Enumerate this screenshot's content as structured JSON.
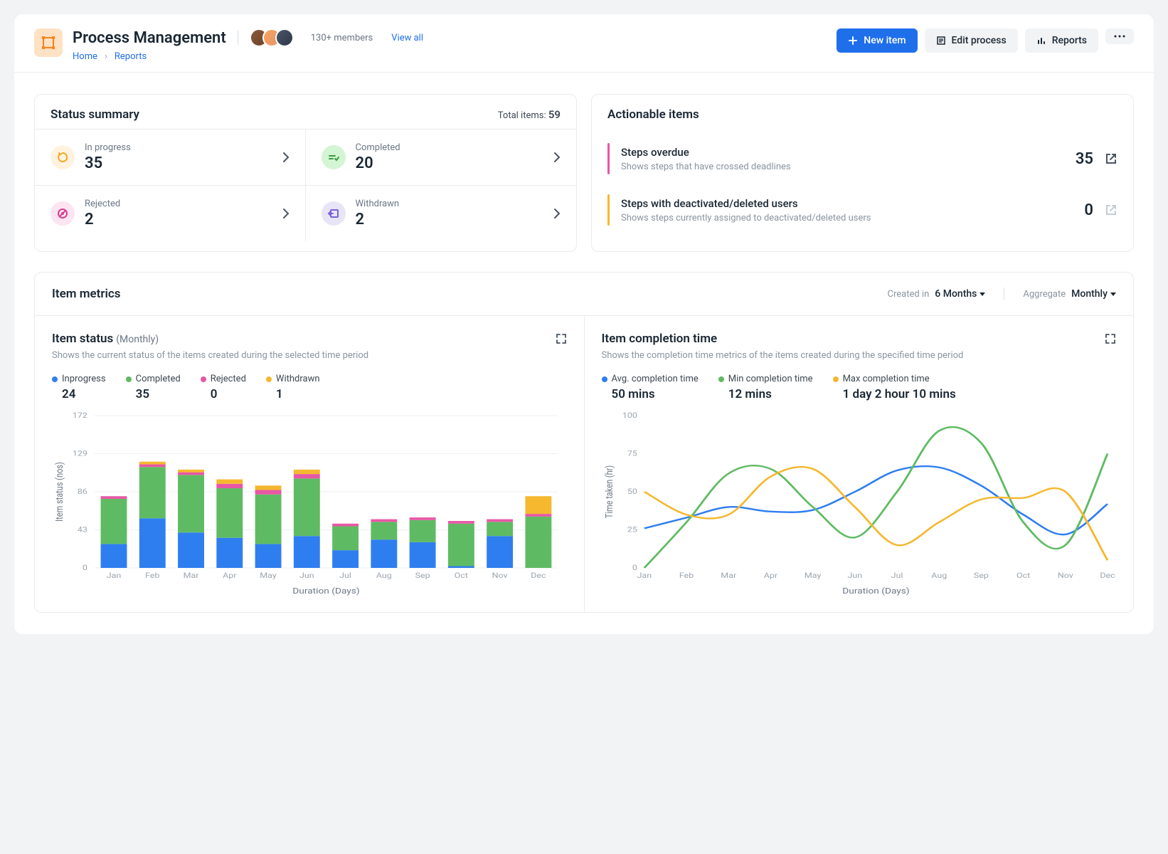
{
  "header": {
    "title": "Process Management",
    "members": "130+ members",
    "view_all": "View all",
    "breadcrumb": {
      "home": "Home",
      "current": "Reports"
    },
    "actions": {
      "new_item": "New item",
      "edit_process": "Edit process",
      "reports": "Reports"
    }
  },
  "status_summary": {
    "title": "Status summary",
    "total_label": "Total items:",
    "total_value": "59",
    "items": [
      {
        "label": "In progress",
        "value": "35"
      },
      {
        "label": "Completed",
        "value": "20"
      },
      {
        "label": "Rejected",
        "value": "2"
      },
      {
        "label": "Withdrawn",
        "value": "2"
      }
    ]
  },
  "actionable": {
    "title": "Actionable items",
    "items": [
      {
        "title": "Steps overdue",
        "desc": "Shows steps that have crossed deadlines",
        "count": "35"
      },
      {
        "title": "Steps with deactivated/deleted users",
        "desc": "Shows steps currently assigned to deactivated/deleted users",
        "count": "0"
      }
    ]
  },
  "item_metrics": {
    "title": "Item metrics",
    "created_in_label": "Created in",
    "created_in_value": "6 Months",
    "aggregate_label": "Aggregate",
    "aggregate_value": "Monthly"
  },
  "item_status_chart": {
    "title": "Item status",
    "subtitle": "(Monthly)",
    "desc": "Shows the current status of the items created during the selected time period",
    "legend": {
      "inprogress": {
        "label": "Inprogress",
        "value": "24"
      },
      "completed": {
        "label": "Completed",
        "value": "35"
      },
      "rejected": {
        "label": "Rejected",
        "value": "0"
      },
      "withdrawn": {
        "label": "Withdrawn",
        "value": "1"
      }
    },
    "xlabel": "Duration (Days)",
    "ylabel": "Item status (nos)"
  },
  "completion_chart": {
    "title": "Item completion time",
    "desc": "Shows the completion time metrics of the items created during the specified time period",
    "legend": {
      "avg": {
        "label": "Avg. completion time",
        "value": "50 mins"
      },
      "min": {
        "label": "Min completion time",
        "value": "12 mins"
      },
      "max": {
        "label": "Max completion time",
        "value": "1 day 2 hour 10 mins"
      }
    },
    "xlabel": "Duration (Days)",
    "ylabel": "Time taken (hr)"
  },
  "chart_data": [
    {
      "type": "bar",
      "stacked": true,
      "title": "Item status (Monthly)",
      "xlabel": "Duration (Days)",
      "ylabel": "Item status (nos)",
      "ylim": [
        0,
        172
      ],
      "yticks": [
        0,
        43,
        86,
        129,
        172
      ],
      "categories": [
        "Jan",
        "Feb",
        "Mar",
        "Apr",
        "May",
        "Jun",
        "Jul",
        "Aug",
        "Sep",
        "Oct",
        "Nov",
        "Dec"
      ],
      "series": [
        {
          "name": "Inprogress",
          "color": "#2f7ef0",
          "values": [
            27,
            56,
            40,
            34,
            27,
            36,
            20,
            32,
            29,
            2,
            36,
            0
          ]
        },
        {
          "name": "Completed",
          "color": "#5fbb63",
          "values": [
            51,
            58,
            65,
            56,
            56,
            65,
            27,
            20,
            25,
            48,
            16,
            58
          ]
        },
        {
          "name": "Rejected",
          "color": "#e857a5",
          "values": [
            3,
            3,
            3,
            5,
            5,
            5,
            3,
            3,
            3,
            3,
            3,
            3
          ]
        },
        {
          "name": "Withdrawn",
          "color": "#f5b82e",
          "values": [
            0,
            3,
            3,
            5,
            5,
            5,
            0,
            0,
            0,
            0,
            0,
            20
          ]
        }
      ]
    },
    {
      "type": "line",
      "title": "Item completion time",
      "xlabel": "Duration (Days)",
      "ylabel": "Time taken (hr)",
      "ylim": [
        0,
        100
      ],
      "yticks": [
        0,
        25,
        50,
        75,
        100
      ],
      "categories": [
        "Jan",
        "Feb",
        "Mar",
        "Apr",
        "May",
        "Jun",
        "Jul",
        "Aug",
        "Sep",
        "Oct",
        "Nov",
        "Dec"
      ],
      "series": [
        {
          "name": "Avg. completion time",
          "color": "#2f7ef0",
          "values": [
            26,
            33,
            40,
            37,
            38,
            50,
            64,
            66,
            54,
            35,
            22,
            42
          ]
        },
        {
          "name": "Min completion time",
          "color": "#5fbb63",
          "values": [
            0,
            30,
            62,
            65,
            40,
            20,
            50,
            90,
            82,
            30,
            15,
            75
          ]
        },
        {
          "name": "Max completion time",
          "color": "#f5b82e",
          "values": [
            50,
            35,
            35,
            60,
            65,
            40,
            15,
            30,
            45,
            46,
            50,
            5
          ]
        }
      ]
    }
  ]
}
